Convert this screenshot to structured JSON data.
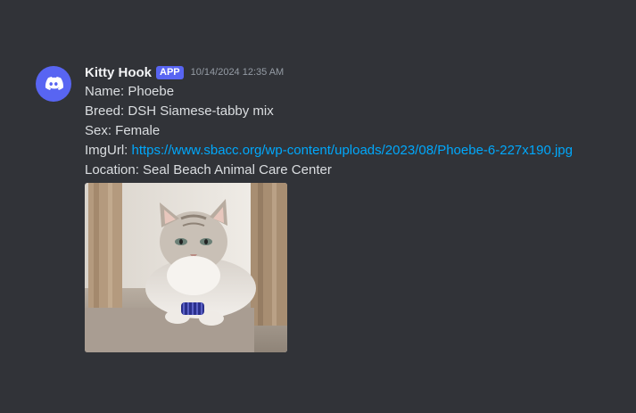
{
  "message": {
    "author": "Kitty Hook",
    "badge": "APP",
    "timestamp": "10/14/2024 12:35 AM",
    "avatar_icon": "discord-logo-icon",
    "lines": {
      "name": "Name: Phoebe",
      "breed": "Breed: DSH Siamese-tabby mix",
      "sex": "Sex: Female",
      "imgurl_label": "ImgUrl: ",
      "imgurl_link": "https://www.sbacc.org/wp-content/uploads/2023/08/Phoebe-6-227x190.jpg",
      "location": "Location: Seal Beach Animal Care Center"
    },
    "image": {
      "description_icon": "cat-photo"
    }
  },
  "colors": {
    "background": "#313338",
    "brand": "#5865f2",
    "link": "#00a8fc",
    "text": "#dbdee1",
    "username": "#f2f3f5",
    "timestamp": "#949ba4"
  }
}
